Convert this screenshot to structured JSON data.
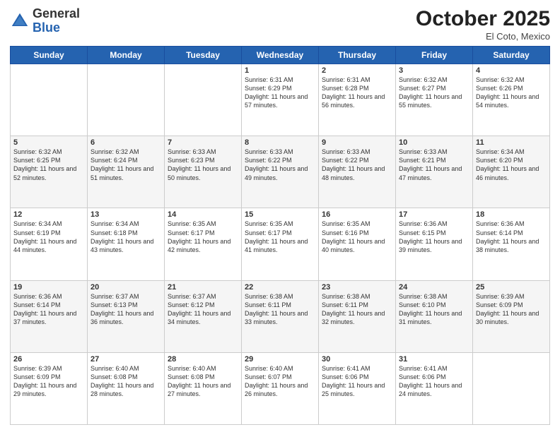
{
  "header": {
    "logo": {
      "general": "General",
      "blue": "Blue"
    },
    "month": "October 2025",
    "location": "El Coto, Mexico"
  },
  "days_of_week": [
    "Sunday",
    "Monday",
    "Tuesday",
    "Wednesday",
    "Thursday",
    "Friday",
    "Saturday"
  ],
  "weeks": [
    [
      {
        "day": null
      },
      {
        "day": null
      },
      {
        "day": null
      },
      {
        "day": "1",
        "sunrise": "6:31 AM",
        "sunset": "6:29 PM",
        "daylight": "11 hours and 57 minutes."
      },
      {
        "day": "2",
        "sunrise": "6:31 AM",
        "sunset": "6:28 PM",
        "daylight": "11 hours and 56 minutes."
      },
      {
        "day": "3",
        "sunrise": "6:32 AM",
        "sunset": "6:27 PM",
        "daylight": "11 hours and 55 minutes."
      },
      {
        "day": "4",
        "sunrise": "6:32 AM",
        "sunset": "6:26 PM",
        "daylight": "11 hours and 54 minutes."
      }
    ],
    [
      {
        "day": "5",
        "sunrise": "6:32 AM",
        "sunset": "6:25 PM",
        "daylight": "11 hours and 52 minutes."
      },
      {
        "day": "6",
        "sunrise": "6:32 AM",
        "sunset": "6:24 PM",
        "daylight": "11 hours and 51 minutes."
      },
      {
        "day": "7",
        "sunrise": "6:33 AM",
        "sunset": "6:23 PM",
        "daylight": "11 hours and 50 minutes."
      },
      {
        "day": "8",
        "sunrise": "6:33 AM",
        "sunset": "6:22 PM",
        "daylight": "11 hours and 49 minutes."
      },
      {
        "day": "9",
        "sunrise": "6:33 AM",
        "sunset": "6:22 PM",
        "daylight": "11 hours and 48 minutes."
      },
      {
        "day": "10",
        "sunrise": "6:33 AM",
        "sunset": "6:21 PM",
        "daylight": "11 hours and 47 minutes."
      },
      {
        "day": "11",
        "sunrise": "6:34 AM",
        "sunset": "6:20 PM",
        "daylight": "11 hours and 46 minutes."
      }
    ],
    [
      {
        "day": "12",
        "sunrise": "6:34 AM",
        "sunset": "6:19 PM",
        "daylight": "11 hours and 44 minutes."
      },
      {
        "day": "13",
        "sunrise": "6:34 AM",
        "sunset": "6:18 PM",
        "daylight": "11 hours and 43 minutes."
      },
      {
        "day": "14",
        "sunrise": "6:35 AM",
        "sunset": "6:17 PM",
        "daylight": "11 hours and 42 minutes."
      },
      {
        "day": "15",
        "sunrise": "6:35 AM",
        "sunset": "6:17 PM",
        "daylight": "11 hours and 41 minutes."
      },
      {
        "day": "16",
        "sunrise": "6:35 AM",
        "sunset": "6:16 PM",
        "daylight": "11 hours and 40 minutes."
      },
      {
        "day": "17",
        "sunrise": "6:36 AM",
        "sunset": "6:15 PM",
        "daylight": "11 hours and 39 minutes."
      },
      {
        "day": "18",
        "sunrise": "6:36 AM",
        "sunset": "6:14 PM",
        "daylight": "11 hours and 38 minutes."
      }
    ],
    [
      {
        "day": "19",
        "sunrise": "6:36 AM",
        "sunset": "6:14 PM",
        "daylight": "11 hours and 37 minutes."
      },
      {
        "day": "20",
        "sunrise": "6:37 AM",
        "sunset": "6:13 PM",
        "daylight": "11 hours and 36 minutes."
      },
      {
        "day": "21",
        "sunrise": "6:37 AM",
        "sunset": "6:12 PM",
        "daylight": "11 hours and 34 minutes."
      },
      {
        "day": "22",
        "sunrise": "6:38 AM",
        "sunset": "6:11 PM",
        "daylight": "11 hours and 33 minutes."
      },
      {
        "day": "23",
        "sunrise": "6:38 AM",
        "sunset": "6:11 PM",
        "daylight": "11 hours and 32 minutes."
      },
      {
        "day": "24",
        "sunrise": "6:38 AM",
        "sunset": "6:10 PM",
        "daylight": "11 hours and 31 minutes."
      },
      {
        "day": "25",
        "sunrise": "6:39 AM",
        "sunset": "6:09 PM",
        "daylight": "11 hours and 30 minutes."
      }
    ],
    [
      {
        "day": "26",
        "sunrise": "6:39 AM",
        "sunset": "6:09 PM",
        "daylight": "11 hours and 29 minutes."
      },
      {
        "day": "27",
        "sunrise": "6:40 AM",
        "sunset": "6:08 PM",
        "daylight": "11 hours and 28 minutes."
      },
      {
        "day": "28",
        "sunrise": "6:40 AM",
        "sunset": "6:08 PM",
        "daylight": "11 hours and 27 minutes."
      },
      {
        "day": "29",
        "sunrise": "6:40 AM",
        "sunset": "6:07 PM",
        "daylight": "11 hours and 26 minutes."
      },
      {
        "day": "30",
        "sunrise": "6:41 AM",
        "sunset": "6:06 PM",
        "daylight": "11 hours and 25 minutes."
      },
      {
        "day": "31",
        "sunrise": "6:41 AM",
        "sunset": "6:06 PM",
        "daylight": "11 hours and 24 minutes."
      },
      {
        "day": null
      }
    ]
  ]
}
